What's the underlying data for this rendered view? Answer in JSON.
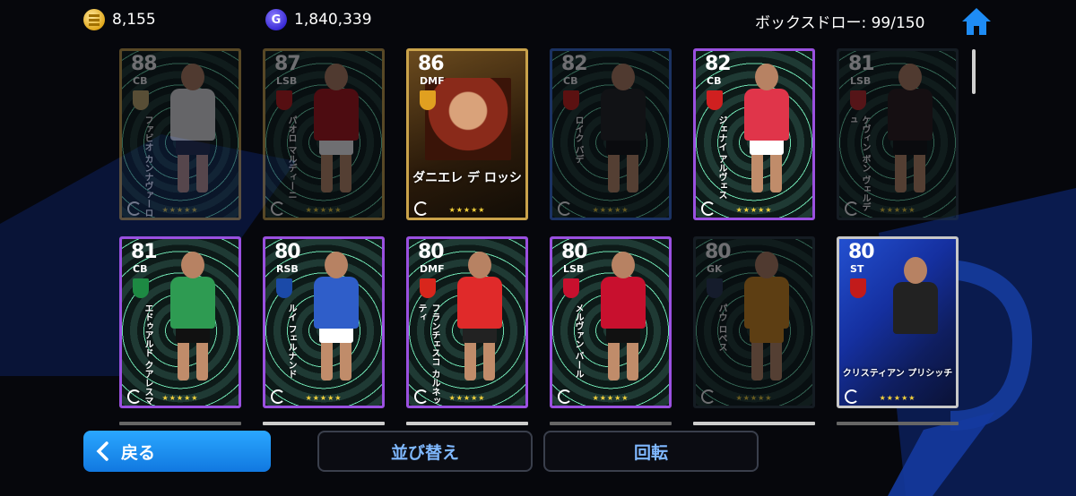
{
  "topbar": {
    "coins": "8,155",
    "gp": "1,840,339",
    "gp_icon_letter": "G",
    "box_draw": "ボックスドロー: 99/150"
  },
  "cards": [
    {
      "rating": "88",
      "position": "CB",
      "name": "ファビオ カンナヴァーロ",
      "stars": "★★★★★",
      "dim": true
    },
    {
      "rating": "87",
      "position": "LSB",
      "name": "パオロ マルディーニ",
      "stars": "★★★★★",
      "dim": true
    },
    {
      "rating": "86",
      "position": "DMF",
      "name": "ダニエレ デ ロッシ",
      "stars": "★★★★★",
      "dim": false
    },
    {
      "rating": "82",
      "position": "CB",
      "name": "ロイク バデ",
      "stars": "★★★★★",
      "dim": true
    },
    {
      "rating": "82",
      "position": "CB",
      "name": "ジェナイ アルヴェス",
      "stars": "★★★★★",
      "dim": false
    },
    {
      "rating": "81",
      "position": "LSB",
      "name": "ケヴィン ボン ヴェルデュ",
      "stars": "★★★★★",
      "dim": true
    },
    {
      "rating": "81",
      "position": "CB",
      "name": "エドゥアルド クアレスマ",
      "stars": "★★★★★",
      "dim": false
    },
    {
      "rating": "80",
      "position": "RSB",
      "name": "ルイ フェルナンド",
      "stars": "★★★★★",
      "dim": false
    },
    {
      "rating": "80",
      "position": "DMF",
      "name": "フランチェスコ カルネッティ",
      "stars": "★★★★★",
      "dim": false
    },
    {
      "rating": "80",
      "position": "LSB",
      "name": "メルヴァン バール",
      "stars": "★★★★★",
      "dim": false
    },
    {
      "rating": "80",
      "position": "GK",
      "name": "パウ ロペス",
      "stars": "★★★★★",
      "dim": true
    },
    {
      "rating": "80",
      "position": "ST",
      "name": "クリスティアン プリシッチ",
      "stars": "★★★★★",
      "dim": false
    }
  ],
  "buttons": {
    "back": "戻る",
    "sort": "並び替え",
    "rotate": "回転"
  },
  "colors": {
    "accent": "#1a8cf0",
    "star": "#f5d23a",
    "gold_frame": "#c9a24a",
    "purple_frame": "#9a50e0",
    "blue_frame": "#3a6ed8"
  }
}
